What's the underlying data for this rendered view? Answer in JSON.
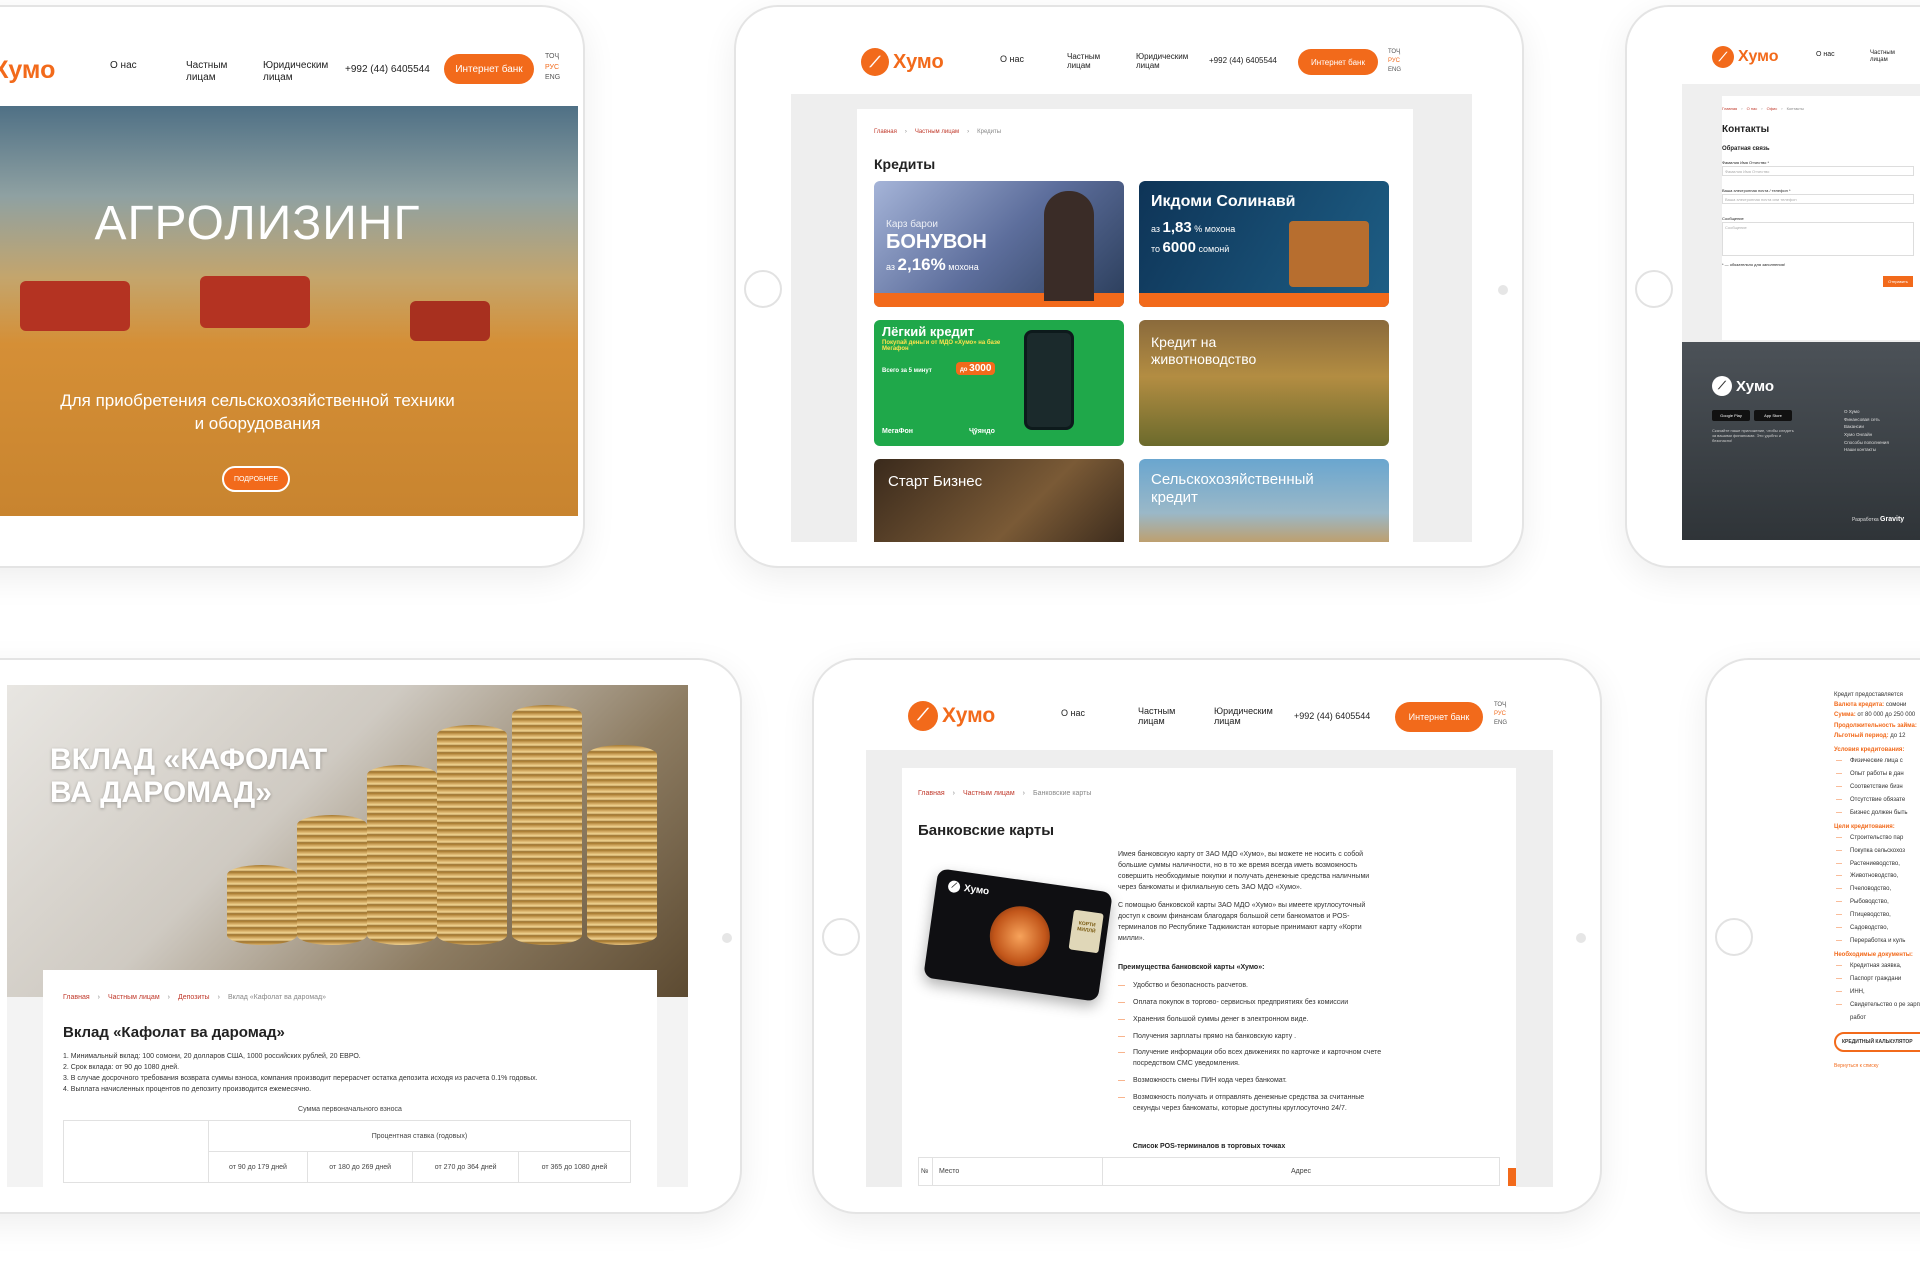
{
  "brand": {
    "name": "Хумо",
    "accent": "#f26a1b"
  },
  "header": {
    "nav_about": "О нас",
    "nav_private": [
      "Частным",
      "лицам"
    ],
    "nav_legal": [
      "Юридическим",
      "лицам"
    ],
    "phone": "+992 (44) 6405544",
    "bank_button": "Интернет банк",
    "lang": {
      "tj": "ТОҶ",
      "ru": "РУС",
      "en": "ENG"
    }
  },
  "agro": {
    "title": "АГРОЛИЗИНГ",
    "subtitle_1": "Для приобретения сельскохозяйственной техники",
    "subtitle_2": "и оборудования",
    "cta": "ПОДРОБНЕЕ"
  },
  "credits": {
    "breadcrumb": [
      "Главная",
      "Частным лицам",
      "Кредиты"
    ],
    "title": "Кредиты",
    "promo1": {
      "kicker": "Карз барои",
      "title": "БОНУВОН",
      "rate": "2,16%",
      "rate_prefix": "аз",
      "rate_suffix": "мохона"
    },
    "promo2": {
      "title": "Икдоми Солинавӣ",
      "line1_prefix": "аз",
      "line1_value": "1,83",
      "line1_suffix": "% мохона",
      "line2_prefix": "то",
      "line2_value": "6000",
      "line2_suffix": "сомонӣ"
    },
    "promo3": {
      "title": "Лёгкий кредит",
      "sub": "Покупай деньги от МДО «Хумо» на базе Мегафон",
      "amount": "3000",
      "amount_prefix": "до",
      "time": "Всего за 5 минут",
      "logo1": "МегаФон",
      "logo2": "Ҷӯяндо"
    },
    "promo4": {
      "title": "Кредит на животноводство"
    },
    "promo5": {
      "title": "Старт Бизнес"
    },
    "promo6": {
      "title": "Сельскохозяйственный кредит"
    }
  },
  "contacts": {
    "breadcrumb": [
      "Главная",
      "О нас",
      "Офис",
      "Контакты"
    ],
    "title": "Контакты",
    "form_title": "Обратная связь",
    "field1_label": "Фамилия Имя Отчество *",
    "field1_placeholder": "Фамилия Имя Отчество",
    "field2_label": "Ваша электронная почта / телефон *",
    "field2_placeholder": "Ваша электронная почта или телефон",
    "field3_label": "Сообщение",
    "field3_placeholder": "Сообщение",
    "required_note": "* — обязательно для заполнения!",
    "submit": "Отправить",
    "footer": {
      "store1": "Google Play",
      "store2": "App Store",
      "links": [
        "О Хумо",
        "Финансовая сеть",
        "Вакансии",
        "Хумо Онлайн",
        "Способы пополнения",
        "Наши контакты"
      ],
      "dev_label": "Разработка",
      "dev_name": "Gravity",
      "app_text": "Скачайте наше приложение, чтобы следить за вашими финансами. Это удобно и безопасно!"
    }
  },
  "deposit": {
    "hero_line1": "ВКЛАД «КАФОЛАТ",
    "hero_line2": "ВА ДАРОМАД»",
    "breadcrumb": [
      "Главная",
      "Частным лицам",
      "Депозиты",
      "Вклад «Кафолат ва даромад»"
    ],
    "title": "Вклад «Кафолат ва даромад»",
    "items": [
      "1. Минимальный вклад: 100 сомони, 20 долларов США, 1000 российских рублей, 20 ЕВРО.",
      "2. Срок вклада: от 90 до 1080 дней.",
      "3. В случае досрочного требования возврата суммы взноса, компания производит перерасчет остатка депозита исходя из расчета 0.1% годовых.",
      "4. Выплата начисленных процентов по депозиту производится ежемесячно."
    ],
    "table_caption": "Сумма первоначального взноса",
    "rate_header": "Процентная ставка (годовых)",
    "periods": [
      "от 90 до 179 дней",
      "от 180 до 269 дней",
      "от 270 до 364 дней",
      "от 365 до 1080 дней"
    ]
  },
  "cards": {
    "breadcrumb": [
      "Главная",
      "Частным лицам",
      "Банковские карты"
    ],
    "title": "Банковские карты",
    "card_brand": "Хумо",
    "card_badge": [
      "КОРТИ",
      "МИЛЛӢ"
    ],
    "para1": "Имея банковскую карту от ЗАО МДО «Хумо», вы можете не носить с собой большие суммы наличности, но в то же время всегда иметь возможность совершить необходимые покупки и получать денежные средства наличными через банкоматы и филиальную сеть ЗАО МДО «Хумо».",
    "para2": "С помощью банковской карты ЗАО МДО «Хумо» вы имеете круглосуточный доступ к своим финансам благодаря большой сети банкоматов и POS-терминалов по Республике Таджикистан которые принимают карту «Корти милли».",
    "benefits_title": "Преимущества банковской карты «Хумо»:",
    "benefits": [
      "Удобство и безопасность расчетов.",
      "Оплата покупок в торгово- сервисных предприятиях без комиссии",
      "Хранения большой суммы денег в электронном виде.",
      "Получения зарплаты прямо на банковскую карту .",
      "Получение информации обо всех движениях по карточке и карточном счете посредством СМС уведомления.",
      "Возможность смены ПИН кода через банкомат.",
      "Возможность получать и отправлять денежные средства за считанные секунды через банкоматы, которые доступны круглосуточно 24/7."
    ],
    "pos_title": "Список POS-терминалов в торговых точках",
    "col_no": "№",
    "col_place": "Место",
    "col_addr": "Адрес"
  },
  "loan": {
    "intro": "Кредит предоставляется",
    "currency_label": "Валюта кредита:",
    "currency_value": "сомони",
    "sum_label": "Сумма:",
    "sum_value": "от 80 000 до 250 000",
    "duration_label": "Продолжительность займа:",
    "grace_label": "Льготный период:",
    "grace_value": "до 12",
    "conditions_title": "Условия кредитования:",
    "conditions": [
      "Физические лица с",
      "Опыт работы в дан",
      "Соответствие бизн",
      "Отсутствие обязате",
      "Бизнес должен быть"
    ],
    "goals_title": "Цели кредитования:",
    "goals": [
      "Строительство пар",
      "Покупка сельскохоз",
      "Растениеводство,",
      "Животноводство,",
      "Пчеловодство,",
      "Рыбоводство,",
      "Птицеводство,",
      "Садоводство,",
      "Переработка и куль"
    ],
    "docs_title": "Необходимые документы:",
    "docs": [
      "Кредитная заявка,",
      "Паспорт граждани",
      "ИНН,",
      "Свидетельство о ре зарплате для работ"
    ],
    "calc_button": "КРЕДИТНЫЙ КАЛЬКУЛЯТОР",
    "back_link": "Вернуться к списку"
  }
}
